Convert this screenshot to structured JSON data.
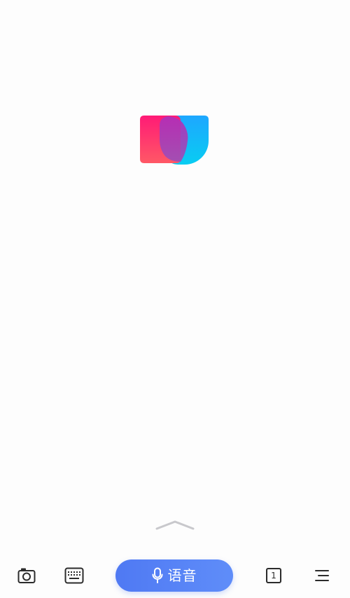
{
  "logo": {
    "name": "app-logo",
    "colors": {
      "left_block": "#ff3d6e",
      "right_block": "#17b9f5",
      "overlap": "#a23fb8"
    }
  },
  "swipe_hint": {
    "icon": "chevron-up-icon"
  },
  "bottom_bar": {
    "camera_icon": "camera-icon",
    "keyboard_icon": "keyboard-icon",
    "voice_button": {
      "icon": "microphone-icon",
      "label": "语音",
      "color": "#5582f6"
    },
    "tabs_count": "1",
    "menu_icon": "menu-icon"
  }
}
